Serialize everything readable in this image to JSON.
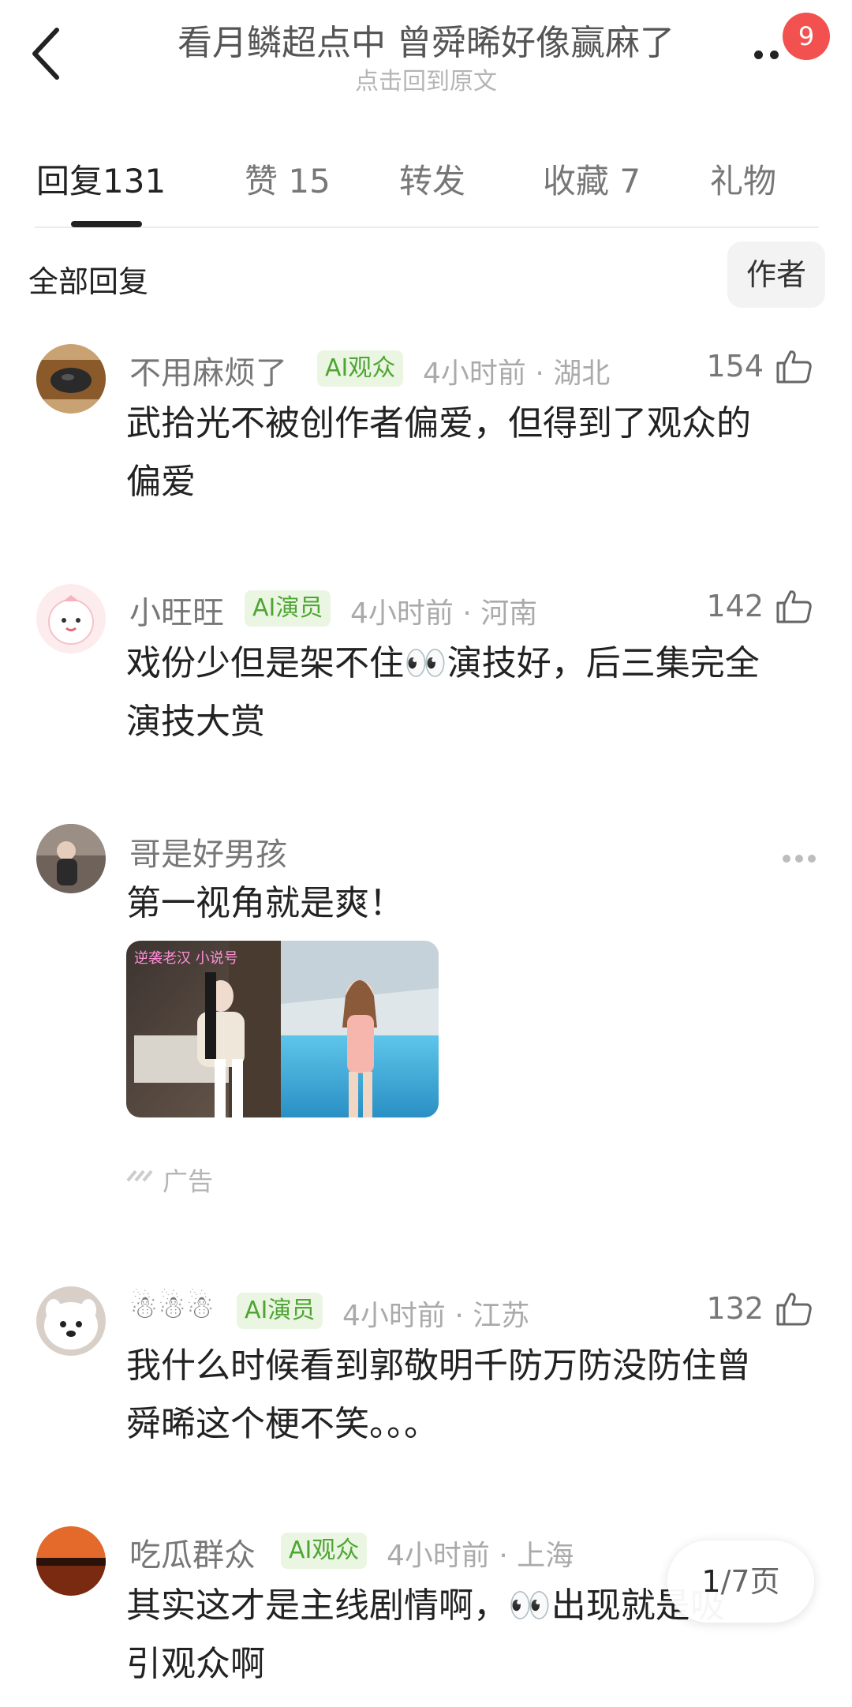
{
  "header": {
    "title": "看月鳞超点中 曾舜晞好像赢麻了",
    "subtitle": "点击回到原文",
    "badge_count": "9"
  },
  "tabs": [
    {
      "label": "回复",
      "count": "131"
    },
    {
      "label": "赞",
      "count": "15"
    },
    {
      "label": "转发",
      "count": ""
    },
    {
      "label": "收藏",
      "count": "7"
    },
    {
      "label": "礼物",
      "count": ""
    }
  ],
  "section": {
    "title": "全部回复",
    "filter_button": "作者"
  },
  "comments": [
    {
      "user": "不用麻烦了",
      "tag": "AI观众",
      "time": "4小时前",
      "location": "湖北",
      "likes": "154",
      "text_lines": [
        "武拾光不被创作者偏爱，但得到了观众的",
        "偏爱"
      ]
    },
    {
      "user": "小旺旺",
      "tag": "AI演员",
      "time": "4小时前",
      "location": "河南",
      "likes": "142",
      "text_lines": [
        "戏份少但是架不住👀演技好，后三集完全",
        "演技大赏"
      ]
    },
    {
      "user": "哥是好男孩",
      "text_lines": [
        "第一视角就是爽！"
      ],
      "ad_label": "广告",
      "image_caption": "逆袭老汉 小说号"
    },
    {
      "user": "☃☃☃",
      "tag": "AI演员",
      "time": "4小时前",
      "location": "江苏",
      "likes": "132",
      "text_lines": [
        "我什么时候看到郭敬明千防万防没防住曾",
        "舜晞这个梗不笑。。。"
      ]
    },
    {
      "user": "吃瓜群众",
      "tag": "AI观众",
      "time": "4小时前",
      "location": "上海",
      "likes": "",
      "text_lines": [
        "其实这才是主线剧情啊，👀出现就是吸",
        "引观众啊"
      ]
    }
  ],
  "pager": {
    "current": "1",
    "total_text": "/7页"
  },
  "colors": {
    "tag_bg": "#eaf6e2",
    "tag_text": "#4fa534",
    "badge": "#f2514f"
  }
}
